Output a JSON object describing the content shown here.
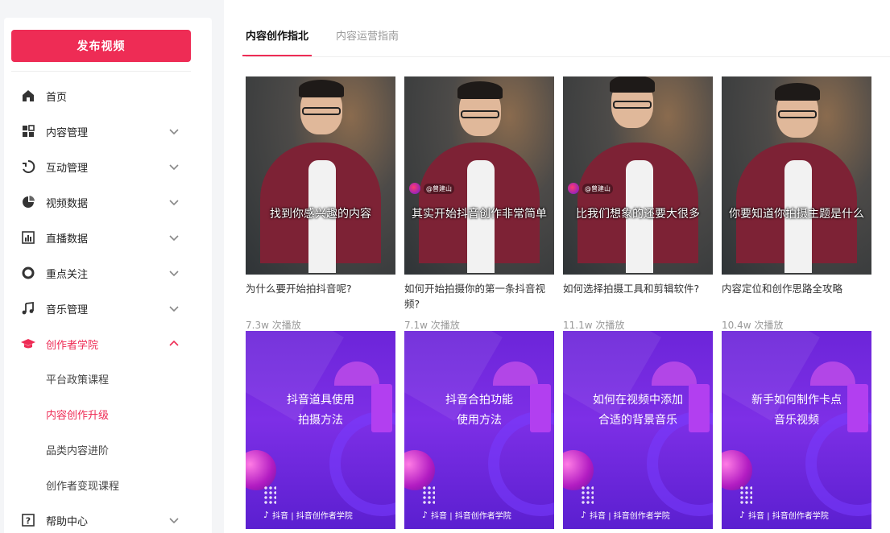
{
  "sidebar": {
    "publish_label": "发布视频",
    "items": [
      {
        "label": "首页",
        "icon": "home-icon"
      },
      {
        "label": "内容管理",
        "icon": "grid-icon"
      },
      {
        "label": "互动管理",
        "icon": "interaction-icon"
      },
      {
        "label": "视频数据",
        "icon": "pie-chart-icon"
      },
      {
        "label": "直播数据",
        "icon": "bar-chart-icon"
      },
      {
        "label": "重点关注",
        "icon": "circle-icon"
      },
      {
        "label": "音乐管理",
        "icon": "music-note-icon"
      },
      {
        "label": "创作者学院",
        "icon": "graduation-cap-icon"
      },
      {
        "label": "帮助中心",
        "icon": "help-icon"
      }
    ],
    "sub_items": [
      "平台政策课程",
      "内容创作升级",
      "品类内容进阶",
      "创作者变现课程"
    ],
    "accent": "#ee2c55"
  },
  "tabs": [
    {
      "label": "内容创作指北"
    },
    {
      "label": "内容运营指南"
    }
  ],
  "videos": [
    {
      "caption": "找到你感兴趣的内容",
      "title": "为什么要开始拍抖音呢?",
      "plays": "7.3w 次播放"
    },
    {
      "caption": "其实开始抖音创作非常简单",
      "title": "如何开始拍摄你的第一条抖音视频?",
      "plays": "7.1w 次播放",
      "watermark": "@曾建山"
    },
    {
      "caption": "比我们想象的还要大很多",
      "title": "如何选择拍摄工具和剪辑软件?",
      "plays": "11.1w 次播放",
      "watermark": "@曾建山"
    },
    {
      "caption": "你要知道你拍摄主题是什么",
      "title": "内容定位和创作思路全攻略",
      "plays": "10.4w 次播放"
    }
  ],
  "promos": [
    {
      "line1": "抖音道具使用",
      "line2": "拍摄方法"
    },
    {
      "line1": "抖音合拍功能",
      "line2": "使用方法"
    },
    {
      "line1": "如何在视频中添加",
      "line2": "合适的背景音乐"
    },
    {
      "line1": "新手如何制作卡点",
      "line2": "音乐视频"
    }
  ],
  "promo_footer": "抖音 | 抖音创作者学院"
}
